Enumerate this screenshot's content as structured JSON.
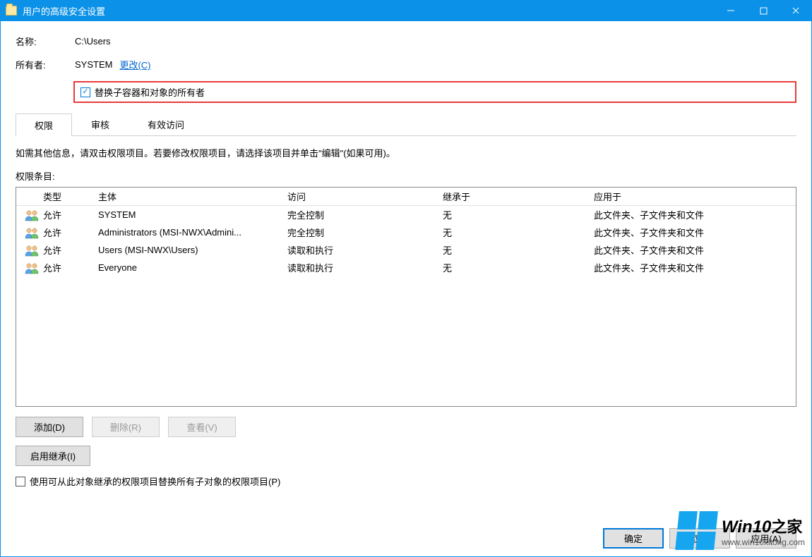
{
  "window": {
    "title": "用户的高级安全设置"
  },
  "labels": {
    "name": "名称:",
    "owner": "所有者:"
  },
  "values": {
    "name": "C:\\Users",
    "owner": "SYSTEM"
  },
  "links": {
    "change_owner": "更改(C)"
  },
  "checkbox": {
    "replace_owner": "替换子容器和对象的所有者",
    "replace_owner_checked": true
  },
  "tabs": {
    "permissions": "权限",
    "audit": "审核",
    "effective": "有效访问",
    "active": "permissions"
  },
  "description": "如需其他信息，请双击权限项目。若要修改权限项目，请选择该项目并单击\"编辑\"(如果可用)。",
  "list_label": "权限条目:",
  "columns": {
    "type": "类型",
    "principal": "主体",
    "access": "访问",
    "inherited_from": "继承于",
    "applies_to": "应用于"
  },
  "entries": [
    {
      "type": "允许",
      "principal": "SYSTEM",
      "access": "完全控制",
      "inherited_from": "无",
      "applies_to": "此文件夹、子文件夹和文件"
    },
    {
      "type": "允许",
      "principal": "Administrators (MSI-NWX\\Admini...",
      "access": "完全控制",
      "inherited_from": "无",
      "applies_to": "此文件夹、子文件夹和文件"
    },
    {
      "type": "允许",
      "principal": "Users (MSI-NWX\\Users)",
      "access": "读取和执行",
      "inherited_from": "无",
      "applies_to": "此文件夹、子文件夹和文件"
    },
    {
      "type": "允许",
      "principal": "Everyone",
      "access": "读取和执行",
      "inherited_from": "无",
      "applies_to": "此文件夹、子文件夹和文件"
    }
  ],
  "buttons": {
    "add": "添加(D)",
    "remove": "删除(R)",
    "view": "查看(V)",
    "enable_inherit": "启用继承(I)",
    "ok": "确定",
    "cancel": "取消",
    "apply": "应用(A)"
  },
  "replace_inherit_checkbox": {
    "label": "使用可从此对象继承的权限项目替换所有子对象的权限项目(P)",
    "checked": false
  },
  "watermark": {
    "line1a": "Win10",
    "line1b": "之家",
    "line2": "www.win10xitong.com"
  }
}
